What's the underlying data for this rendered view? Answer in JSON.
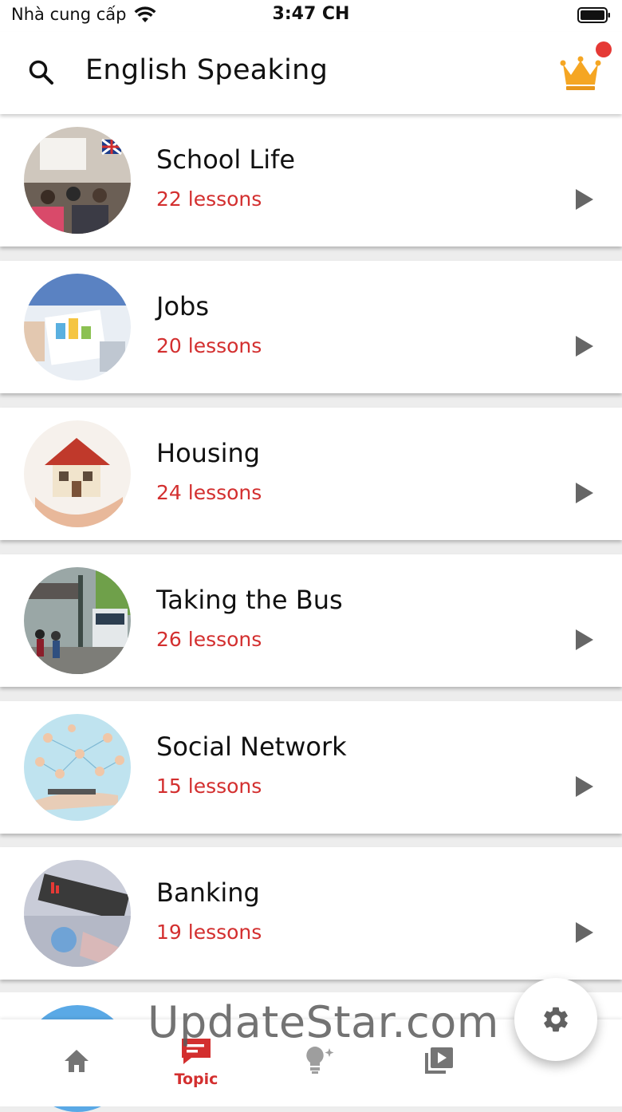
{
  "status_bar": {
    "carrier": "Nhà cung cấp",
    "time": "3:47 CH",
    "wifi_icon": "wifi-icon",
    "battery_icon": "battery-icon"
  },
  "app_bar": {
    "title": "English Speaking",
    "search_icon": "search-icon",
    "premium_icon": "crown-icon",
    "notification_badge_color": "#e53935"
  },
  "topics": [
    {
      "title": "School Life",
      "count": "22 lessons"
    },
    {
      "title": "Jobs",
      "count": "20 lessons"
    },
    {
      "title": "Housing",
      "count": "24 lessons"
    },
    {
      "title": "Taking the Bus",
      "count": "26 lessons"
    },
    {
      "title": "Social Network",
      "count": "15 lessons"
    },
    {
      "title": "Banking",
      "count": "19 lessons"
    }
  ],
  "bottom_nav": {
    "items": [
      {
        "icon": "home-icon",
        "label": ""
      },
      {
        "icon": "topic-icon",
        "label": "Topic",
        "active": true
      },
      {
        "icon": "lightbulb-icon",
        "label": ""
      },
      {
        "icon": "video-library-icon",
        "label": ""
      }
    ]
  },
  "fab": {
    "icon": "gear-icon"
  },
  "watermark": "UpdateStar.com",
  "colors": {
    "accent": "#d32f2f",
    "crown": "#f5a623",
    "icon_gray": "#757575"
  }
}
